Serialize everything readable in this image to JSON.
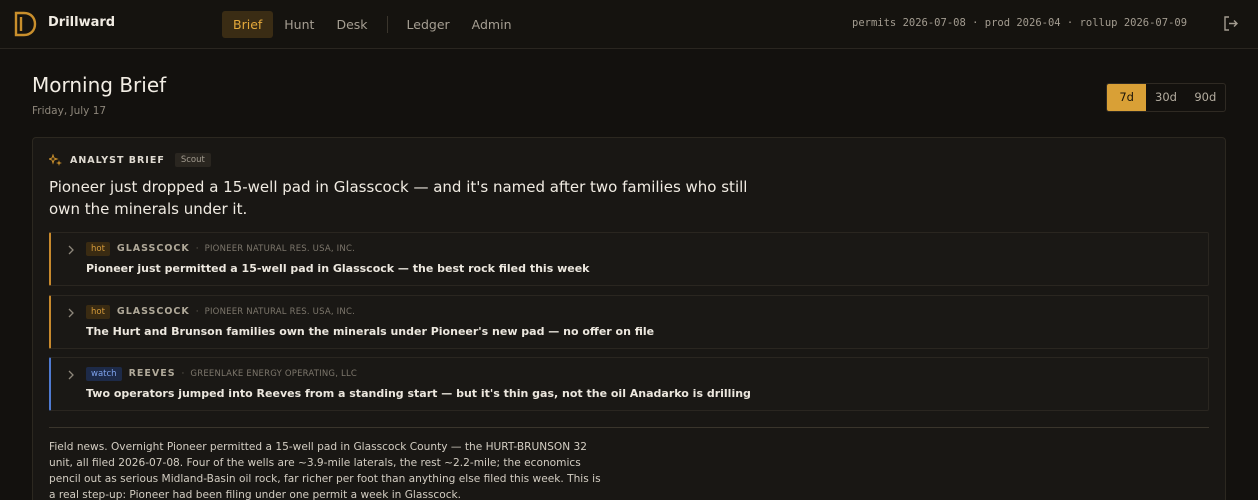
{
  "app": {
    "brand": "Drillward"
  },
  "nav": {
    "items": [
      {
        "label": "Brief",
        "active": true
      },
      {
        "label": "Hunt",
        "active": false
      },
      {
        "label": "Desk",
        "active": false
      },
      {
        "label": "Ledger",
        "active": false
      },
      {
        "label": "Admin",
        "active": false
      }
    ]
  },
  "status": {
    "text": "permits 2026-07-08 · prod 2026-04 · rollup 2026-07-09"
  },
  "header": {
    "title": "Morning Brief",
    "date": "Friday, July 17"
  },
  "range": {
    "options": [
      "7d",
      "30d",
      "90d"
    ],
    "selected": "7d"
  },
  "brief": {
    "label": "ANALYST BRIEF",
    "badge": "Scout",
    "headline": "Pioneer just dropped a 15-well pad in Glasscock — and it's named after two families who still own the minerals under it.",
    "stories": [
      {
        "tag": "hot",
        "county": "GLASSCOCK",
        "operator": "PIONEER NATURAL RES. USA, INC.",
        "title": "Pioneer just permitted a 15-well pad in Glasscock — the best rock filed this week"
      },
      {
        "tag": "hot",
        "county": "GLASSCOCK",
        "operator": "PIONEER NATURAL RES. USA, INC.",
        "title": "The Hurt and Brunson families own the minerals under Pioneer's new pad — no offer on file"
      },
      {
        "tag": "watch",
        "county": "REEVES",
        "operator": "GREENLAKE ENERGY OPERATING, LLC",
        "title": "Two operators jumped into Reeves from a standing start — but it's thin gas, not the oil Anadarko is drilling"
      }
    ],
    "news": "Field news. Overnight Pioneer permitted a 15-well pad in Glasscock County — the HURT-BRUNSON 32 unit, all filed 2026-07-08. Four of the wells are ~3.9-mile laterals, the rest ~2.2-mile; the economics pencil out as serious Midland-Basin oil rock, far richer per foot than anything else filed this week. This is a real step-up: Pioneer had been filing under one permit a week in Glasscock."
  },
  "colors": {
    "accent": "#d9a036",
    "hot": "#c7892d",
    "watch": "#4f7ad0",
    "background": "#13110e"
  },
  "icons": {
    "logo": "drillward-logo",
    "logout": "logout-icon",
    "sparkle": "sparkle-icon",
    "chevron": "chevron-right-icon"
  }
}
